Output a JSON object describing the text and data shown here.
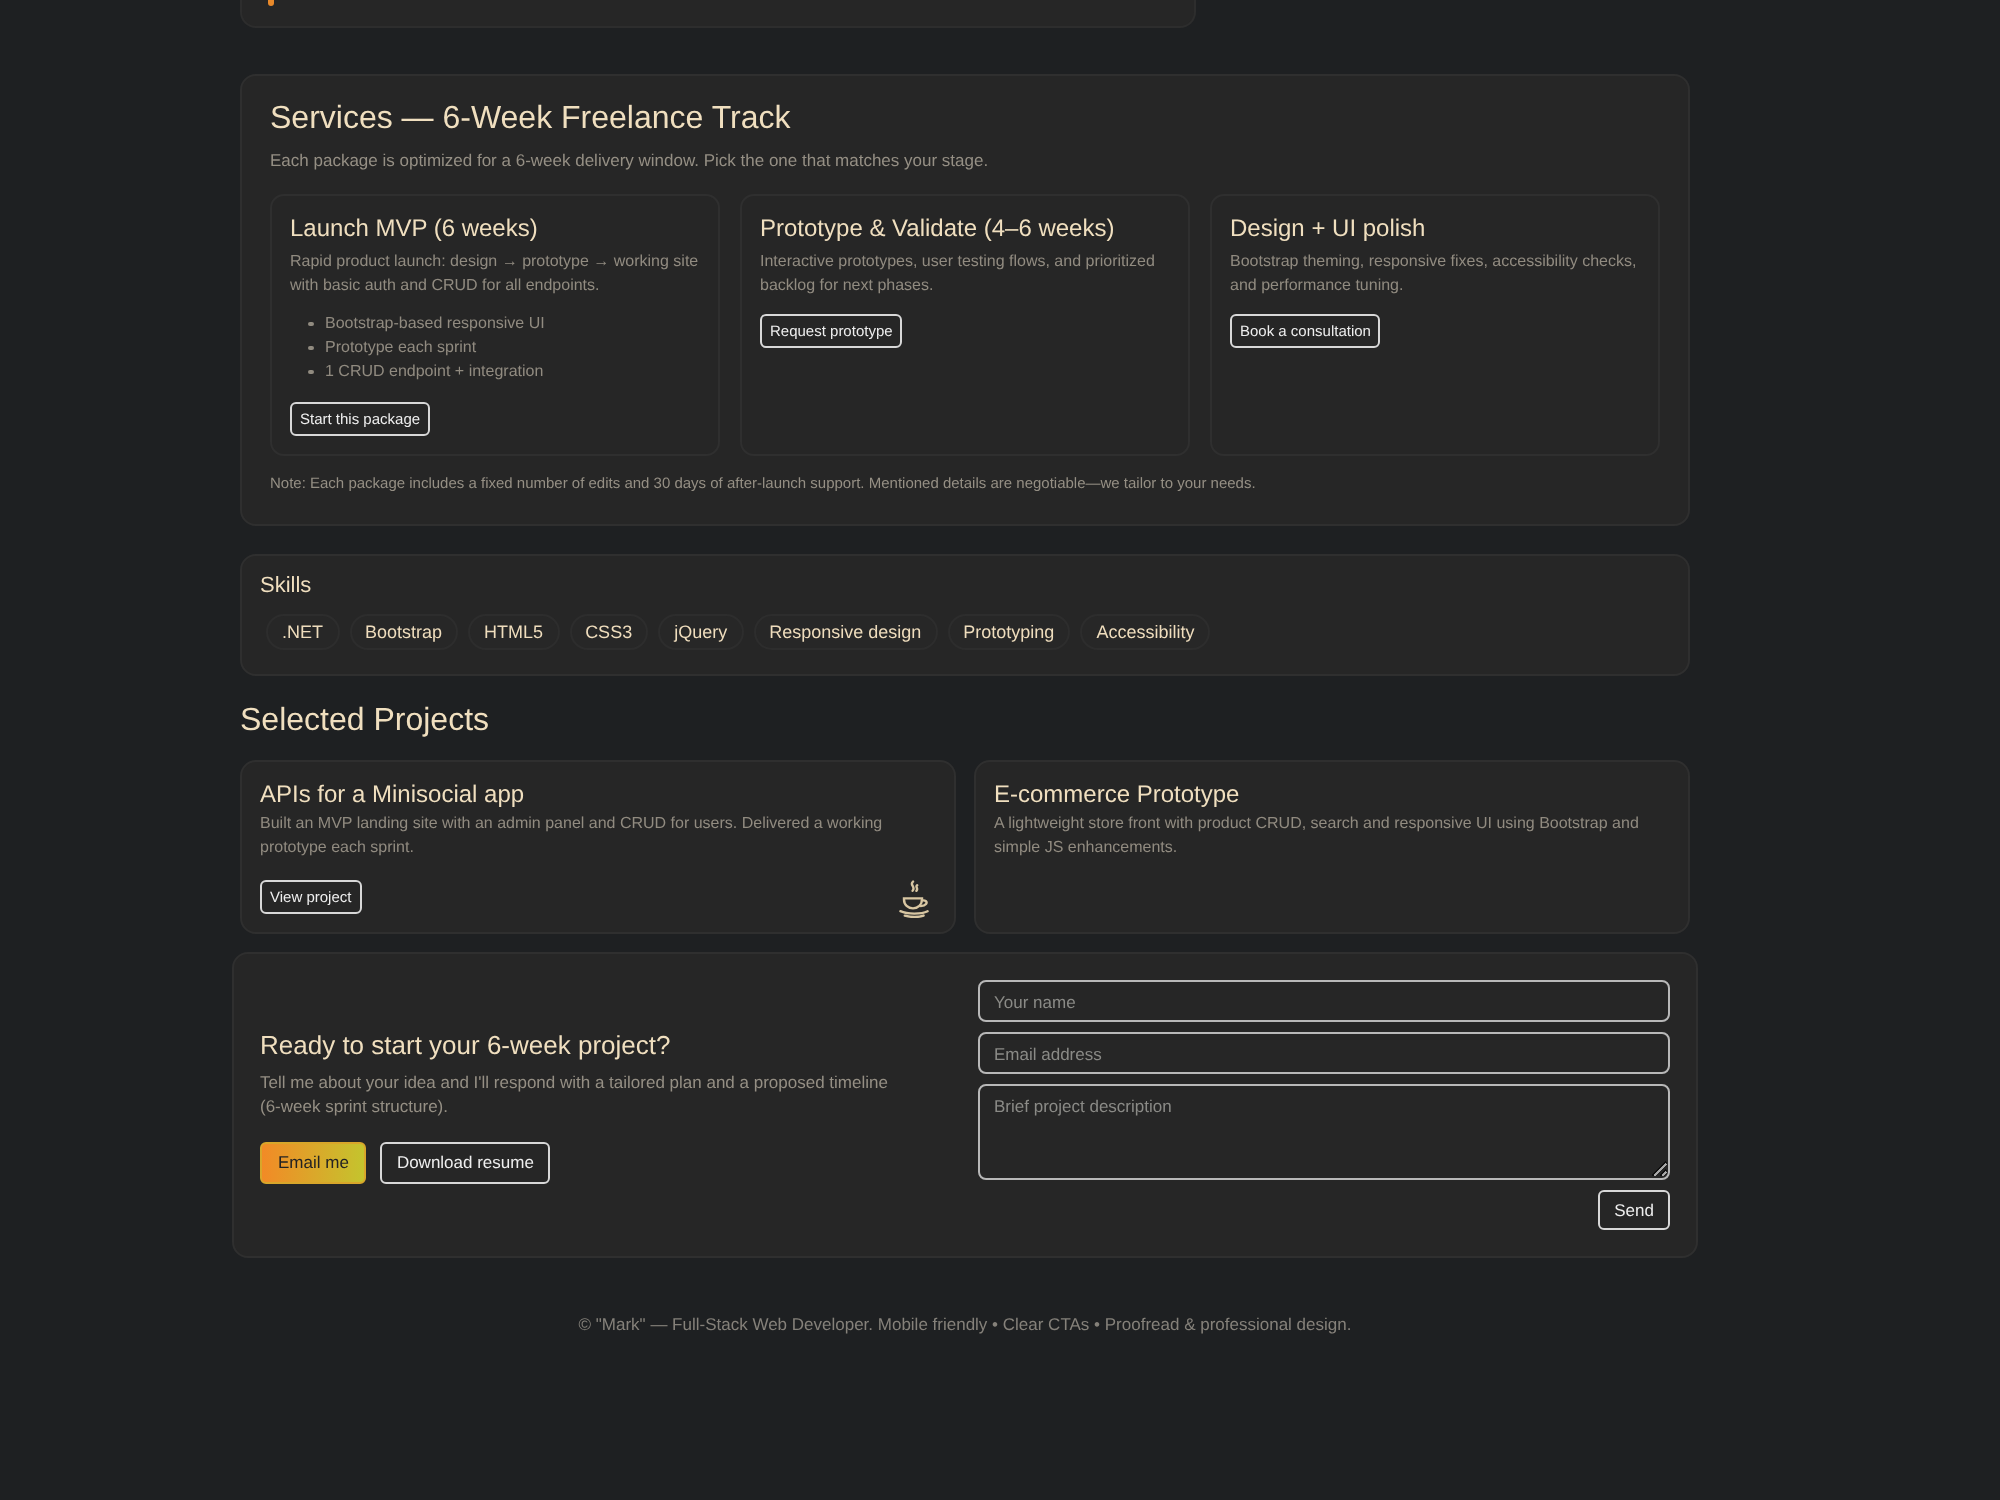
{
  "services": {
    "title": "Services — 6-Week Freelance Track",
    "subtitle": "Each package is optimized for a 6-week delivery window. Pick the one that matches your stage.",
    "packages": [
      {
        "title": "Launch MVP (6 weeks)",
        "description": "Rapid product launch: design → prototype → working site with basic auth and CRUD for all endpoints.",
        "features": [
          "Bootstrap-based responsive UI",
          "Prototype each sprint",
          "1 CRUD endpoint + integration"
        ],
        "button": "Start this package"
      },
      {
        "title": "Prototype & Validate (4–6 weeks)",
        "description": "Interactive prototypes, user testing flows, and prioritized backlog for next phases.",
        "button": "Request prototype"
      },
      {
        "title": "Design + UI polish",
        "description": "Bootstrap theming, responsive fixes, accessibility checks, and performance tuning.",
        "button": "Book a consultation"
      }
    ],
    "note": "Note: Each package includes a fixed number of edits and 30 days of after-launch support. Mentioned details are negotiable—we tailor to your needs."
  },
  "skills": {
    "title": "Skills",
    "items": [
      ".NET",
      "Bootstrap",
      "HTML5",
      "CSS3",
      "jQuery",
      "Responsive design",
      "Prototyping",
      "Accessibility"
    ]
  },
  "projects": {
    "title": "Selected Projects",
    "items": [
      {
        "kind": "detailed",
        "title": "APIs for a Minisocial app",
        "description": "Built an MVP landing site with an admin panel and CRUD for users. Delivered a working prototype each sprint.",
        "button": "View project"
      },
      {
        "kind": "summary",
        "title": "E-commerce Prototype",
        "description": "A lightweight store front with product CRUD, search and responsive UI using Bootstrap and simple JS enhancements."
      }
    ]
  },
  "contact": {
    "title": "Ready to start your 6-week project?",
    "text": "Tell me about your idea and I'll respond with a tailored plan and a proposed timeline (6-week sprint structure).",
    "buttons": [
      {
        "kind": "primary",
        "label": "Email me"
      },
      {
        "kind": "outline",
        "label": "Download resume"
      }
    ],
    "form": {
      "fields": [
        {
          "kind": "input",
          "placeholder": "Your name"
        },
        {
          "kind": "input",
          "placeholder": "Email address"
        },
        {
          "kind": "textarea",
          "placeholder": "Brief project description"
        }
      ],
      "submit": "Send"
    }
  },
  "footer": {
    "text": "© \"Mark\" — Full-Stack Web Developer. Mobile friendly • Clear CTAs • Proofread & professional design."
  }
}
